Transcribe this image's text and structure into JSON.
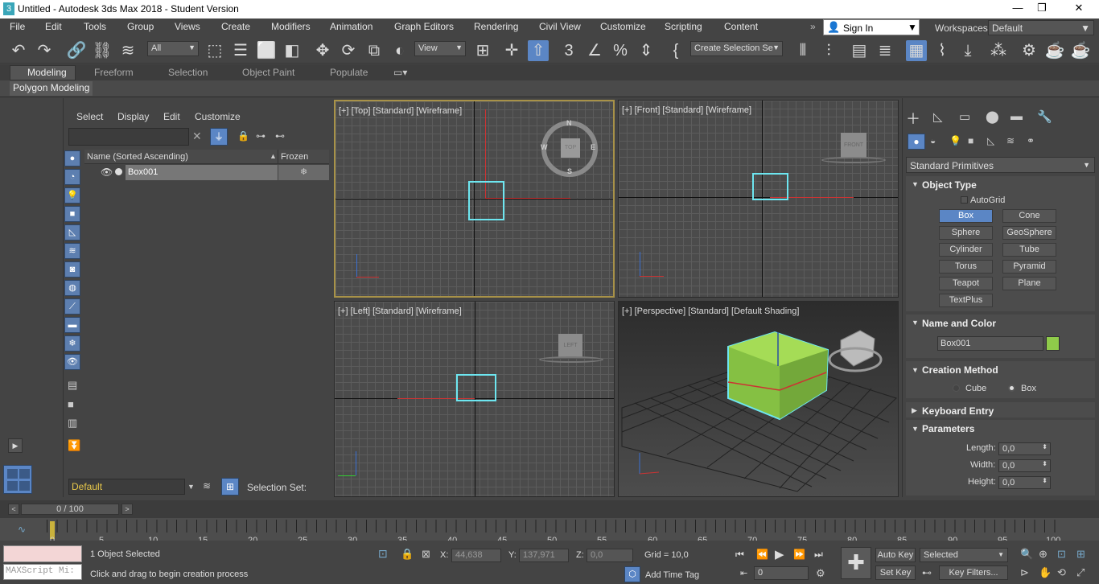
{
  "window": {
    "title": "Untitled - Autodesk 3ds Max 2018 - Student Version",
    "minimize": "—",
    "restore": "❐",
    "close": "✕"
  },
  "menus": [
    "File",
    "Edit",
    "Tools",
    "Group",
    "Views",
    "Create",
    "Modifiers",
    "Animation",
    "Graph Editors",
    "Rendering",
    "Civil View",
    "Customize",
    "Scripting",
    "Content"
  ],
  "account": {
    "signin": "Sign In",
    "workspaces_label": "Workspaces:",
    "workspace": "Default"
  },
  "toolbar": {
    "filter": "All",
    "refcoord": "View",
    "selection_set": "Create Selection Se"
  },
  "ribbon": {
    "tabs": [
      "Modeling",
      "Freeform",
      "Selection",
      "Object Paint",
      "Populate"
    ],
    "active": "Modeling",
    "sub": "Polygon Modeling"
  },
  "scene_explorer": {
    "menu": [
      "Select",
      "Display",
      "Edit",
      "Customize"
    ],
    "col_name": "Name (Sorted Ascending)",
    "col_frozen": "Frozen",
    "rows": [
      {
        "name": "Box001"
      }
    ],
    "layer": "Default",
    "selection_set": "Selection Set:"
  },
  "viewports": {
    "top": "[+] [Top] [Standard] [Wireframe]",
    "front": "[+] [Front] [Standard] [Wireframe]",
    "left": "[+] [Left] [Standard] [Wireframe]",
    "persp": "[+] [Perspective] [Standard] [Default Shading]",
    "compass": {
      "n": "N",
      "s": "S",
      "e": "E",
      "w": "W"
    },
    "cubes": {
      "top": "TOP",
      "front": "FRONT",
      "left": "LEFT"
    }
  },
  "command_panel": {
    "category": "Standard Primitives",
    "object_type": "Object Type",
    "autogrid": "AutoGrid",
    "buttons": [
      "Box",
      "Cone",
      "Sphere",
      "GeoSphere",
      "Cylinder",
      "Tube",
      "Torus",
      "Pyramid",
      "Teapot",
      "Plane",
      "TextPlus"
    ],
    "active_button": "Box",
    "name_color": "Name and Color",
    "object_name": "Box001",
    "object_color": "#8fcb4a",
    "creation_method": "Creation Method",
    "cm_cube": "Cube",
    "cm_box": "Box",
    "keyboard_entry": "Keyboard Entry",
    "parameters": "Parameters",
    "length_label": "Length:",
    "length": "0,0",
    "width_label": "Width:",
    "width": "0,0",
    "height_label": "Height:",
    "height": "0,0"
  },
  "timeline": {
    "frame": "0 / 100",
    "ticks": [
      "0",
      "5",
      "10",
      "15",
      "20",
      "25",
      "30",
      "35",
      "40",
      "45",
      "50",
      "55",
      "60",
      "65",
      "70",
      "75",
      "80",
      "85",
      "90",
      "95",
      "100"
    ]
  },
  "status": {
    "maxscript": "MAXScript Mi:",
    "selected": "1 Object Selected",
    "prompt": "Click and drag to begin creation process",
    "x_label": "X:",
    "x": "44,638",
    "y_label": "Y:",
    "y": "137,971",
    "z_label": "Z:",
    "z": "0,0",
    "grid": "Grid = 10,0",
    "add_time_tag": "Add Time Tag",
    "auto_key": "Auto Key",
    "set_key": "Set Key",
    "key_mode": "Selected",
    "key_filters": "Key Filters...",
    "current_frame": "0"
  },
  "colors": {
    "selection_cyan": "#6de6f0",
    "accent_blue": "#5b86c5",
    "box_green": "#8fcb4a"
  }
}
